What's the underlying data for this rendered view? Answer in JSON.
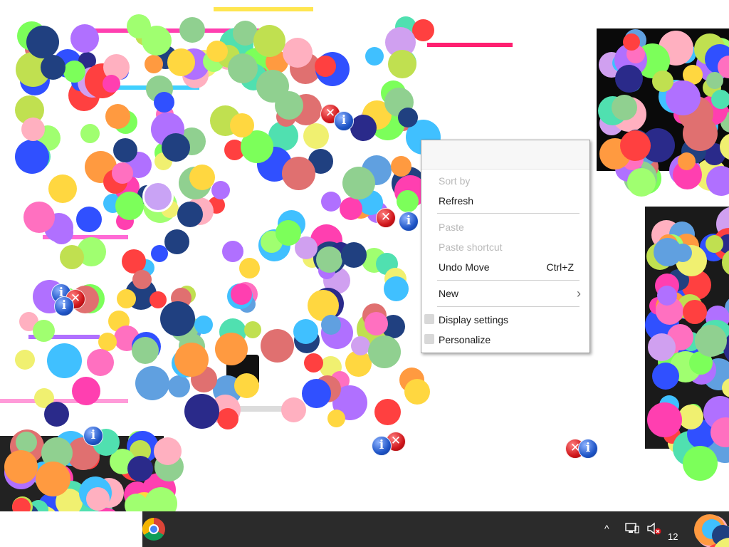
{
  "context_menu": {
    "items": [
      {
        "label": "Sort by",
        "disabled": true
      },
      {
        "label": "Refresh",
        "disabled": false
      },
      {
        "label": "Paste",
        "disabled": true
      },
      {
        "label": "Paste shortcut",
        "disabled": true
      },
      {
        "label": "Undo Move",
        "shortcut": "Ctrl+Z",
        "disabled": false
      },
      {
        "label": "New",
        "submenu": true,
        "disabled": false
      },
      {
        "label": "Display settings",
        "disabled": false
      },
      {
        "label": "Personalize",
        "disabled": false
      }
    ]
  },
  "notification_icons": {
    "info_glyph": "i",
    "error_glyph": "✕"
  },
  "taskbar": {
    "pinned": [
      "chrome-icon"
    ],
    "tray": {
      "chevron": "^",
      "network_icon": "network-icon",
      "volume_icon": "volume-muted-icon",
      "clock": "12"
    }
  },
  "colors": {
    "taskbar_bg": "#2b2b2b",
    "menu_bg": "#ffffff",
    "menu_border": "#a0a0a0",
    "info_blue": "#1f55c7",
    "error_red": "#d0161b"
  }
}
